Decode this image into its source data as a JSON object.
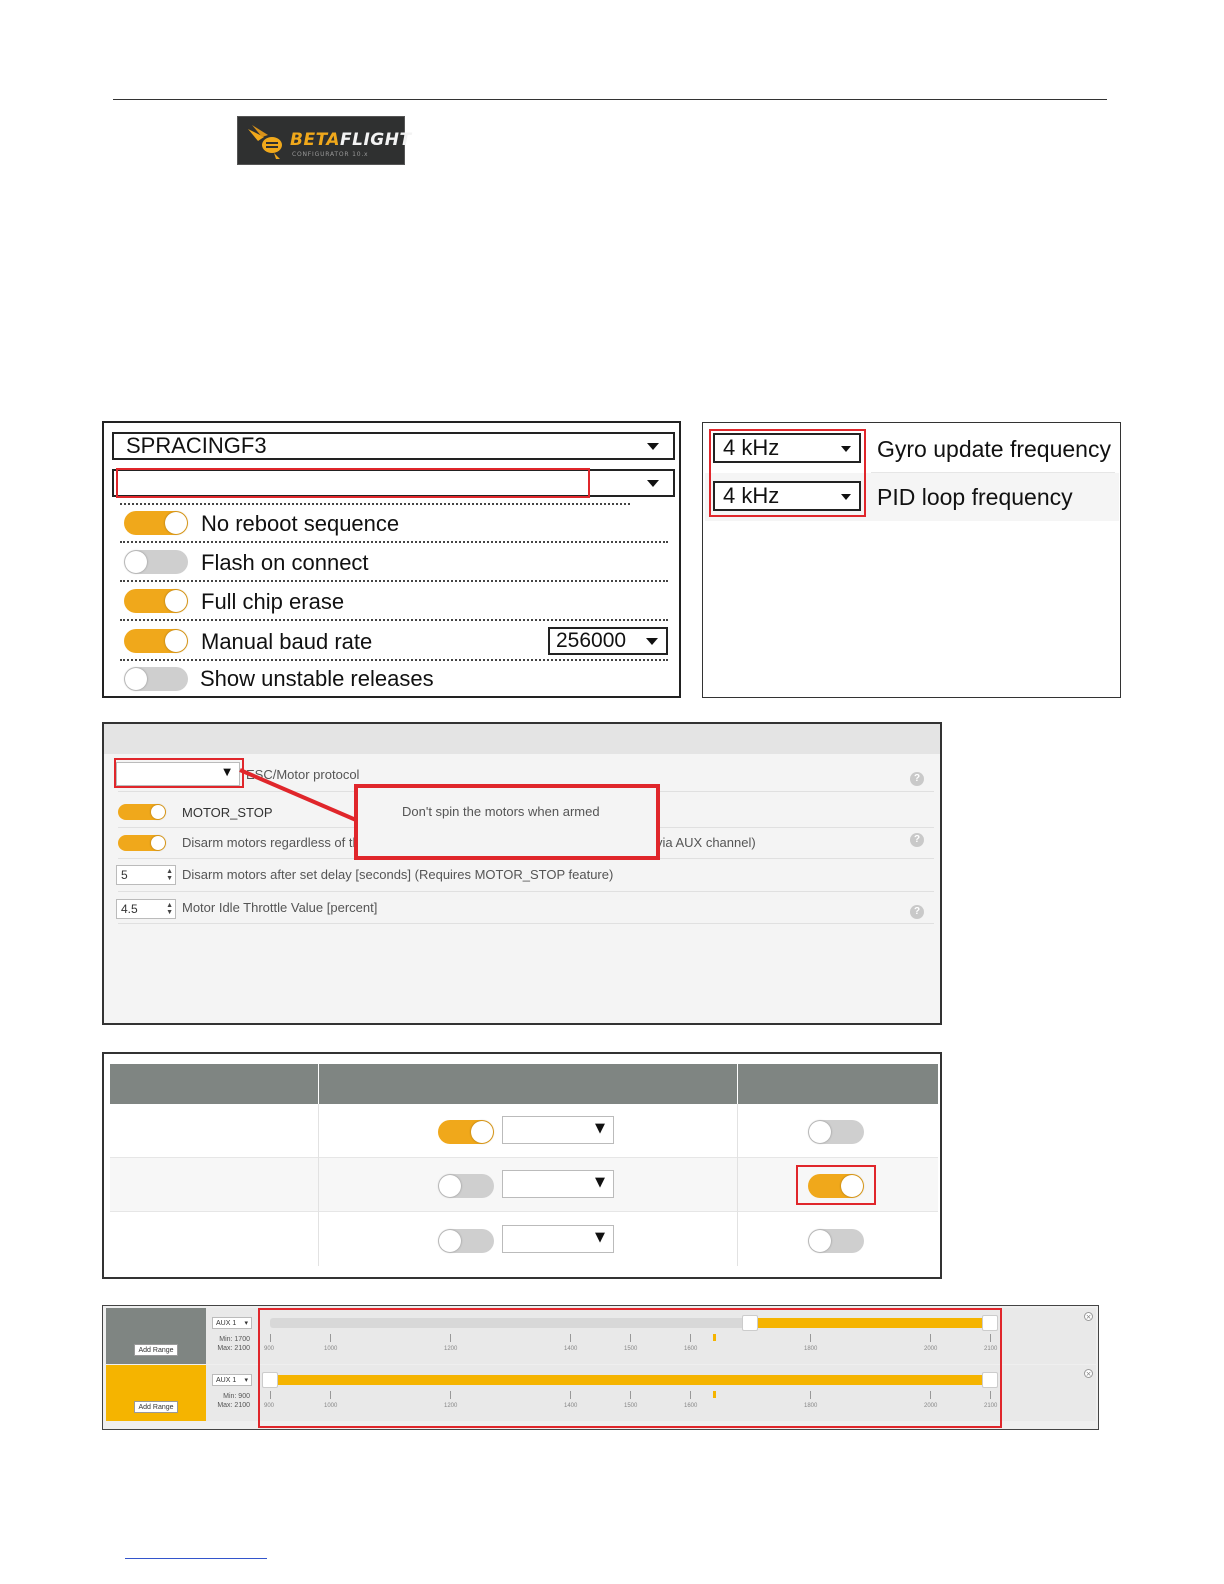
{
  "logo": {
    "brand_a": "BETA",
    "brand_b": "FLIGHT",
    "sub": "CONFIGURATOR 10.x"
  },
  "firmware_flasher": {
    "board_select": "SPRACINGF3",
    "version_select": "",
    "options": [
      {
        "label": "No reboot sequence",
        "enabled": true
      },
      {
        "label": "Flash on connect",
        "enabled": false
      },
      {
        "label": "Full chip erase",
        "enabled": true
      },
      {
        "label": "Manual baud rate",
        "enabled": true
      },
      {
        "label": "Show unstable releases",
        "enabled": false
      }
    ],
    "baud_rate": "256000"
  },
  "frequencies": {
    "gyro": {
      "value": "4 kHz",
      "label": "Gyro update frequency"
    },
    "pid": {
      "value": "4 kHz",
      "label": "PID loop frequency"
    }
  },
  "configuration": {
    "esc_protocol_value": "",
    "esc_protocol_label": "ESC/Motor protocol",
    "motor_stop_label": "MOTOR_STOP",
    "motor_stop_tooltip": "Don't spin the motors when armed",
    "disarm_label": "Disarm motors regardless of throttle value (When ARM is configured in Modes tab via AUX channel)",
    "disarm_delay_value": "5",
    "disarm_delay_label": "Disarm motors after set delay [seconds] (Requires MOTOR_STOP feature)",
    "idle_throttle_value": "4.5",
    "idle_throttle_label": "Motor Idle Throttle Value [percent]",
    "help_glyph": "?"
  },
  "table_rows": [
    {
      "toggle_a": true,
      "select": "",
      "toggle_b": false
    },
    {
      "toggle_a": false,
      "select": "",
      "toggle_b": true
    },
    {
      "toggle_a": false,
      "select": "",
      "toggle_b": false
    }
  ],
  "modes": {
    "ranges": [
      {
        "aux": "AUX 1",
        "min_label": "Min: 1700",
        "max_label": "Max: 2100",
        "min": 1700,
        "max": 2100,
        "active": false,
        "add_label": "Add Range"
      },
      {
        "aux": "AUX 1",
        "min_label": "Min: 900",
        "max_label": "Max: 2100",
        "min": 900,
        "max": 2100,
        "active": true,
        "add_label": "Add Range"
      }
    ],
    "scale_labels": [
      "900",
      "1000",
      "1200",
      "1400",
      "1500",
      "1600",
      "1800",
      "2000",
      "2100"
    ],
    "current_value": 1640,
    "accent_color": "#f5b400"
  },
  "colors": {
    "accent": "#f0a81b",
    "highlight": "#e0262b",
    "header_gray": "#7f8582"
  }
}
